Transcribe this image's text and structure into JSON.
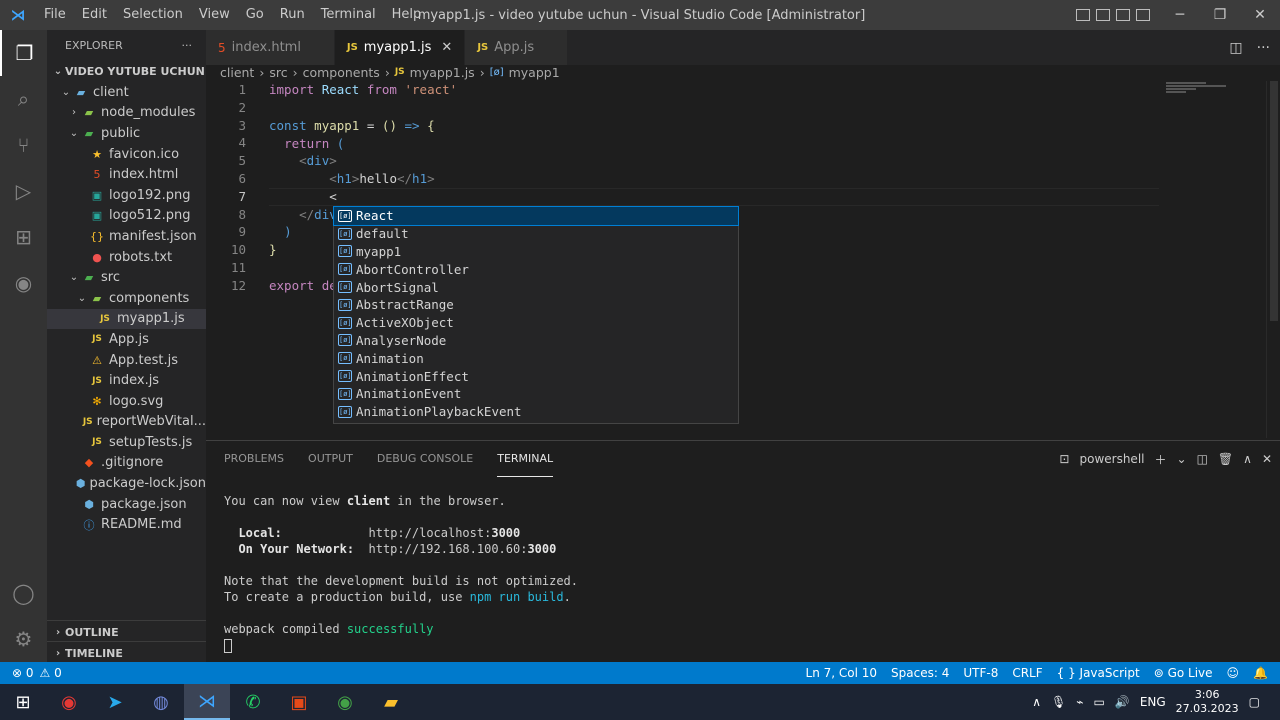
{
  "window": {
    "title": "myapp1.js - video yutube uchun - Visual Studio Code [Administrator]",
    "menu": [
      "File",
      "Edit",
      "Selection",
      "View",
      "Go",
      "Run",
      "Terminal",
      "Help"
    ]
  },
  "explorer": {
    "header": "EXPLORER",
    "more": "···",
    "root": "VIDEO YUTUBE UCHUN",
    "items": [
      {
        "label": "client",
        "indent": 1,
        "chev": "⌄",
        "icon": "folder-icon",
        "glyph": "▰",
        "color": "#6ab0de"
      },
      {
        "label": "node_modules",
        "indent": 2,
        "chev": "›",
        "icon": "folder-icon",
        "glyph": "▰",
        "color": "#8bc34a"
      },
      {
        "label": "public",
        "indent": 2,
        "chev": "⌄",
        "icon": "folder-icon",
        "glyph": "▰",
        "color": "#4caf50"
      },
      {
        "label": "favicon.ico",
        "indent": 3,
        "chev": "",
        "icon": "star-icon",
        "glyph": "★",
        "color": "#fbc02d"
      },
      {
        "label": "index.html",
        "indent": 3,
        "chev": "",
        "icon": "html-file-icon",
        "glyph": "5",
        "color": "#e44d26"
      },
      {
        "label": "logo192.png",
        "indent": 3,
        "chev": "",
        "icon": "image-file-icon",
        "glyph": "▣",
        "color": "#26a69a"
      },
      {
        "label": "logo512.png",
        "indent": 3,
        "chev": "",
        "icon": "image-file-icon",
        "glyph": "▣",
        "color": "#26a69a"
      },
      {
        "label": "manifest.json",
        "indent": 3,
        "chev": "",
        "icon": "json-file-icon",
        "glyph": "{}",
        "color": "#fbc02d"
      },
      {
        "label": "robots.txt",
        "indent": 3,
        "chev": "",
        "icon": "robot-file-icon",
        "glyph": "●",
        "color": "#ef5350"
      },
      {
        "label": "src",
        "indent": 2,
        "chev": "⌄",
        "icon": "folder-icon",
        "glyph": "▰",
        "color": "#4caf50"
      },
      {
        "label": "components",
        "indent": 3,
        "chev": "⌄",
        "icon": "folder-icon",
        "glyph": "▰",
        "color": "#8bc34a"
      },
      {
        "label": "myapp1.js",
        "indent": 4,
        "chev": "",
        "icon": "js-file-icon",
        "glyph": "JS",
        "color": "#e8c73c",
        "selected": true
      },
      {
        "label": "App.js",
        "indent": 3,
        "chev": "",
        "icon": "js-file-icon",
        "glyph": "JS",
        "color": "#e8c73c"
      },
      {
        "label": "App.test.js",
        "indent": 3,
        "chev": "",
        "icon": "test-file-icon",
        "glyph": "⚠",
        "color": "#fbc02d"
      },
      {
        "label": "index.js",
        "indent": 3,
        "chev": "",
        "icon": "js-file-icon",
        "glyph": "JS",
        "color": "#e8c73c"
      },
      {
        "label": "logo.svg",
        "indent": 3,
        "chev": "",
        "icon": "svg-file-icon",
        "glyph": "✻",
        "color": "#ffb300"
      },
      {
        "label": "reportWebVital...",
        "indent": 3,
        "chev": "",
        "icon": "js-file-icon",
        "glyph": "JS",
        "color": "#e8c73c"
      },
      {
        "label": "setupTests.js",
        "indent": 3,
        "chev": "",
        "icon": "js-file-icon",
        "glyph": "JS",
        "color": "#e8c73c"
      },
      {
        "label": ".gitignore",
        "indent": 2,
        "chev": "",
        "icon": "git-file-icon",
        "glyph": "◆",
        "color": "#f4511e"
      },
      {
        "label": "package-lock.json",
        "indent": 2,
        "chev": "",
        "icon": "npm-file-icon",
        "glyph": "⬢",
        "color": "#6ab0de"
      },
      {
        "label": "package.json",
        "indent": 2,
        "chev": "",
        "icon": "npm-file-icon",
        "glyph": "⬢",
        "color": "#6ab0de"
      },
      {
        "label": "README.md",
        "indent": 2,
        "chev": "",
        "icon": "info-file-icon",
        "glyph": "ⓘ",
        "color": "#42a5f5"
      }
    ],
    "outline": "OUTLINE",
    "timeline": "TIMELINE"
  },
  "tabs": [
    {
      "label": "index.html",
      "kind": "html",
      "active": false
    },
    {
      "label": "myapp1.js",
      "kind": "js",
      "active": true
    },
    {
      "label": "App.js",
      "kind": "js",
      "active": false
    }
  ],
  "breadcrumb": [
    "client",
    "src",
    "components",
    "myapp1.js",
    "myapp1"
  ],
  "code": {
    "line_numbers": [
      "1",
      "2",
      "3",
      "4",
      "5",
      "6",
      "7",
      "8",
      "9",
      "10",
      "11",
      "12"
    ],
    "current_line": "7"
  },
  "suggestions": [
    "React",
    "default",
    "myapp1",
    "AbortController",
    "AbortSignal",
    "AbstractRange",
    "ActiveXObject",
    "AnalyserNode",
    "Animation",
    "AnimationEffect",
    "AnimationEvent",
    "AnimationPlaybackEvent"
  ],
  "panel": {
    "tabs": [
      "PROBLEMS",
      "OUTPUT",
      "DEBUG CONSOLE",
      "TERMINAL"
    ],
    "active_tab": "TERMINAL",
    "shell": "powershell",
    "terminal": {
      "view_pre": "You can now view ",
      "view_app": "client",
      "view_post": " in the browser.",
      "local_label": "Local:",
      "local_url_pre": "http://localhost:",
      "local_port": "3000",
      "network_label": "On Your Network:",
      "network_url_pre": "http://192.168.100.60:",
      "network_port": "3000",
      "note1": "Note that the development build is not optimized.",
      "note2_pre": "To create a production build, use ",
      "note2_cmd": "npm run build",
      "note2_post": ".",
      "compiled_pre": "webpack compiled ",
      "compiled_status": "successfully"
    }
  },
  "status": {
    "errors": "⊗ 0",
    "warnings": "⚠ 0",
    "position": "Ln 7, Col 10",
    "spaces": "Spaces: 4",
    "encoding": "UTF-8",
    "eol": "CRLF",
    "language": "{ } JavaScript",
    "golive": "⊚ Go Live"
  },
  "taskbar": {
    "lang": "ENG",
    "time": "3:06",
    "date": "27.03.2023"
  },
  "colors": {
    "status_bar": "#007acc",
    "suggest_selected": "#04395e"
  }
}
